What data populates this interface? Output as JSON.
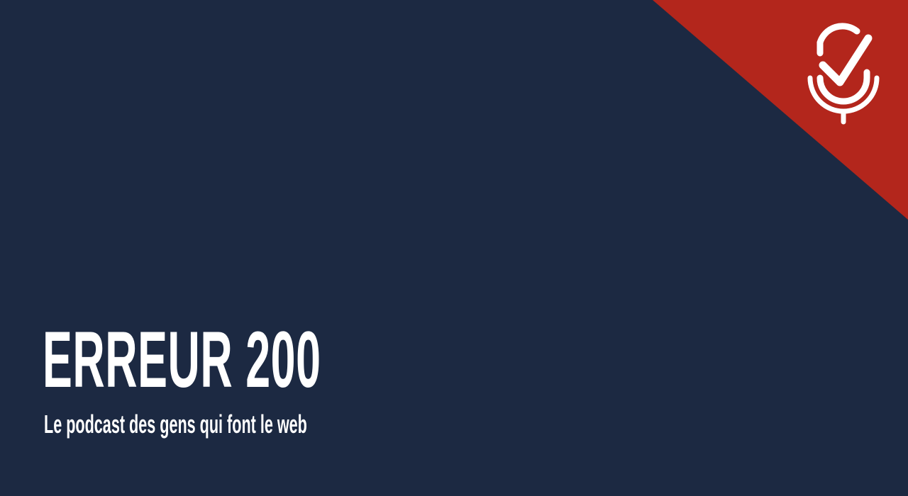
{
  "podcast": {
    "title": "ERREUR 200",
    "tagline": "Le podcast des gens qui font le web"
  },
  "logo": {
    "icon": "microphone-check-icon"
  },
  "colors": {
    "background": "#1c2942",
    "accent": "#b3261c",
    "text": "#ffffff"
  }
}
